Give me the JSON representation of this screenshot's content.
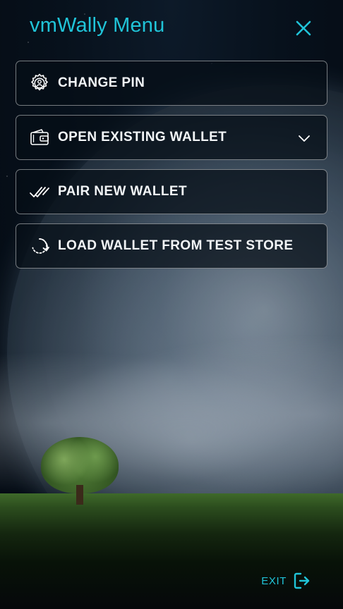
{
  "header": {
    "title": "vmWally Menu",
    "close_icon": "close-icon"
  },
  "menu": {
    "items": [
      {
        "label": "CHANGE PIN",
        "icon": "settings-user-icon"
      },
      {
        "label": "OPEN EXISTING WALLET",
        "icon": "wallet-icon",
        "has_dropdown": true
      },
      {
        "label": "PAIR NEW WALLET",
        "icon": "double-check-icon"
      },
      {
        "label": "LOAD WALLET FROM TEST STORE",
        "icon": "reload-icon"
      }
    ]
  },
  "footer": {
    "exit_label": "EXIT",
    "exit_icon": "exit-icon"
  },
  "colors": {
    "accent": "#20c4d8",
    "item_text": "#f2f5f7",
    "item_border": "rgba(255,255,255,0.45)"
  }
}
